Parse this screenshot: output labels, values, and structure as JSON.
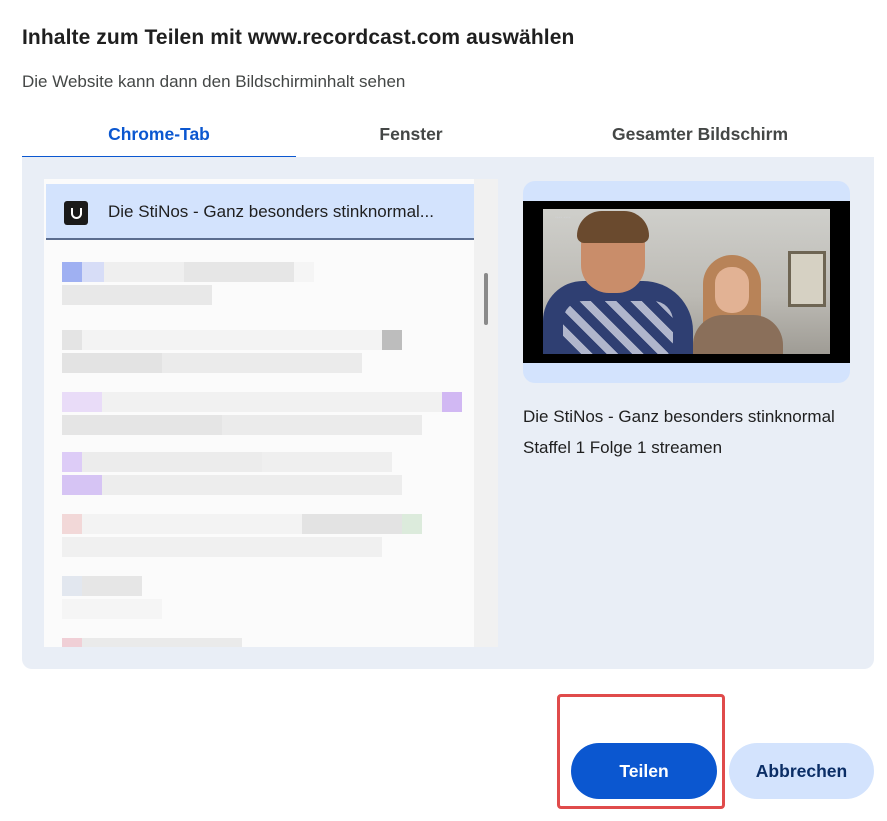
{
  "dialog": {
    "title": "Inhalte zum Teilen mit www.recordcast.com auswählen",
    "subtitle": "Die Website kann dann den Bildschirminhalt sehen"
  },
  "tabs": [
    {
      "label": "Chrome-Tab",
      "selected": true
    },
    {
      "label": "Fenster",
      "selected": false
    },
    {
      "label": "Gesamter Bildschirm",
      "selected": false
    }
  ],
  "tab_list": {
    "selected_item": {
      "label": "Die StiNos - Ganz besonders stinknormal...",
      "favicon": "stinos-logo-icon"
    },
    "blurred_items_count": 7
  },
  "preview": {
    "title": "Die StiNos - Ganz besonders stinknormal Staffel 1 Folge 1 streamen"
  },
  "buttons": {
    "share_label": "Teilen",
    "cancel_label": "Abbrechen"
  },
  "colors": {
    "accent": "#0b57d0",
    "panel_bg": "#e9eef6",
    "selected_bg": "#d3e3fd",
    "highlight_border": "#e04b4b"
  }
}
